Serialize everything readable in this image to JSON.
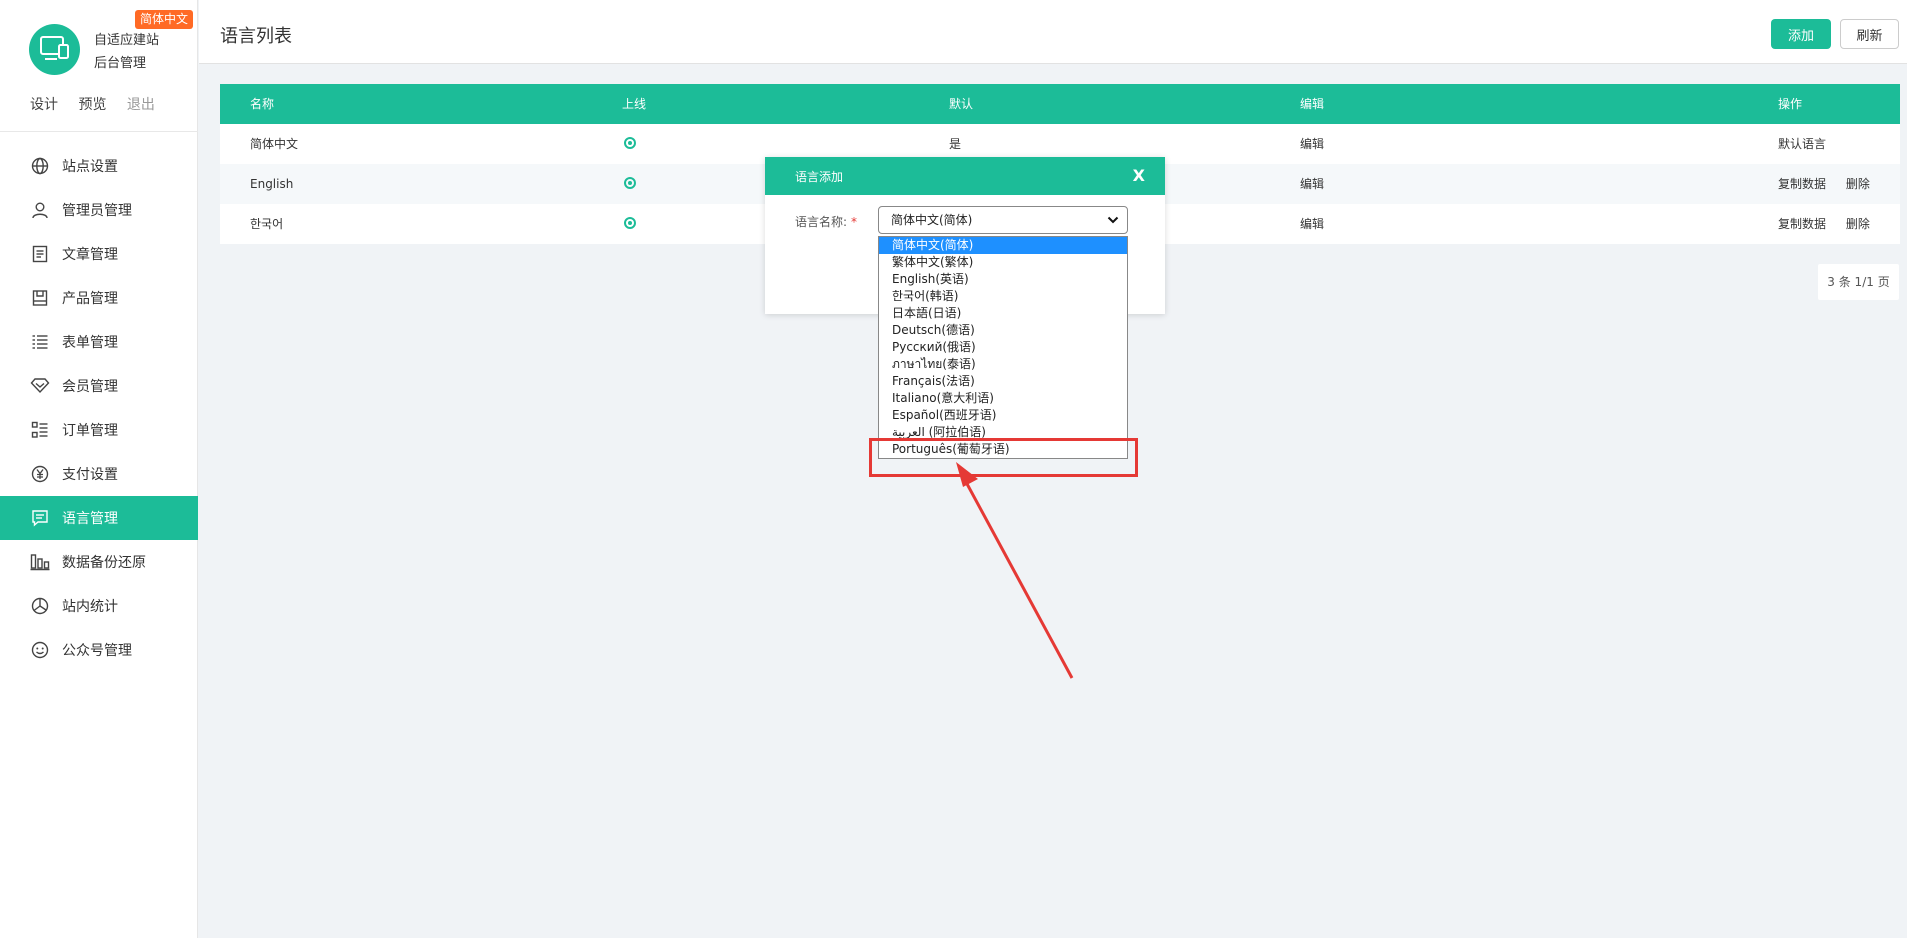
{
  "brand": {
    "badge": "简体中文",
    "title_line1": "自适应建站",
    "title_line2": "后台管理",
    "actions": [
      "设计",
      "预览",
      "退出"
    ]
  },
  "menu": [
    {
      "label": "站点设置",
      "icon": "globe-icon"
    },
    {
      "label": "管理员管理",
      "icon": "user-icon"
    },
    {
      "label": "文章管理",
      "icon": "document-icon"
    },
    {
      "label": "产品管理",
      "icon": "box-icon"
    },
    {
      "label": "表单管理",
      "icon": "list-icon"
    },
    {
      "label": "会员管理",
      "icon": "diamond-icon"
    },
    {
      "label": "订单管理",
      "icon": "order-list-icon"
    },
    {
      "label": "支付设置",
      "icon": "yen-icon"
    },
    {
      "label": "语言管理",
      "icon": "chat-icon",
      "active": true
    },
    {
      "label": "数据备份还原",
      "icon": "bar-chart-icon"
    },
    {
      "label": "站内统计",
      "icon": "pie-chart-icon"
    },
    {
      "label": "公众号管理",
      "icon": "smile-icon"
    }
  ],
  "topbar": {
    "title": "语言列表",
    "add_label": "添加",
    "refresh_label": "刷新"
  },
  "table": {
    "headers": [
      "名称",
      "上线",
      "默认",
      "编辑",
      "操作"
    ],
    "rows": [
      {
        "name": "简体中文",
        "default": "是",
        "edit": "编辑",
        "ops": [
          "默认语言"
        ]
      },
      {
        "name": "English",
        "default": "",
        "edit": "编辑",
        "ops": [
          "复制数据",
          "删除"
        ]
      },
      {
        "name": "한국어",
        "default": "",
        "edit": "编辑",
        "ops": [
          "复制数据",
          "删除"
        ]
      }
    ]
  },
  "pager": "3 条 1/1 页",
  "modal": {
    "title": "语言添加",
    "close": "X",
    "field_label": "语言名称:",
    "required_mark": "*",
    "selected_value": "简体中文(简体)",
    "options": [
      "简体中文(简体)",
      "繁体中文(繁体)",
      "English(英语)",
      "한국어(韩语)",
      "日本語(日语)",
      "Deutsch(德语)",
      "Русский(俄语)",
      "ภาษาไทย(泰语)",
      "Français(法语)",
      "Italiano(意大利语)",
      "Español(西班牙语)",
      "العربية (阿拉伯语)",
      "Português(葡萄牙语)"
    ]
  },
  "colors": {
    "accent": "#1cbc98",
    "badge": "#ff6a25",
    "annotation": "#e53935",
    "option_selected": "#1e90ff"
  }
}
